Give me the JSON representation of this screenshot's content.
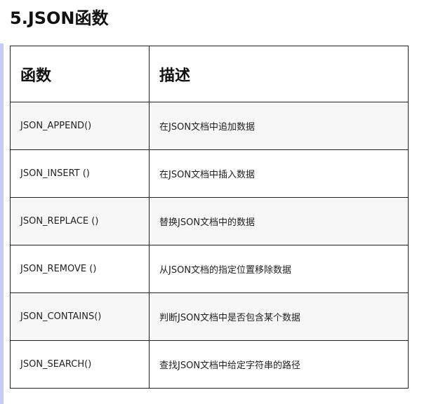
{
  "section": {
    "title": "5.JSON函数"
  },
  "table": {
    "headers": [
      "函数",
      "描述"
    ],
    "rows": [
      [
        "JSON_APPEND()",
        "在JSON文档中追加数据"
      ],
      [
        "JSON_INSERT ()",
        "在JSON文档中插入数据"
      ],
      [
        "JSON_REPLACE ()",
        "替换JSON文档中的数据"
      ],
      [
        "JSON_REMOVE ()",
        "从JSON文档的指定位置移除数据"
      ],
      [
        "JSON_CONTAINS()",
        "判断JSON文档中是否包含某个数据"
      ],
      [
        "JSON_SEARCH()",
        "查找JSON文档中给定字符串的路径"
      ]
    ]
  },
  "colors": {
    "accent_bar": "#c4ccf5",
    "stripe": "#f7f7f7",
    "border": "#222222"
  }
}
